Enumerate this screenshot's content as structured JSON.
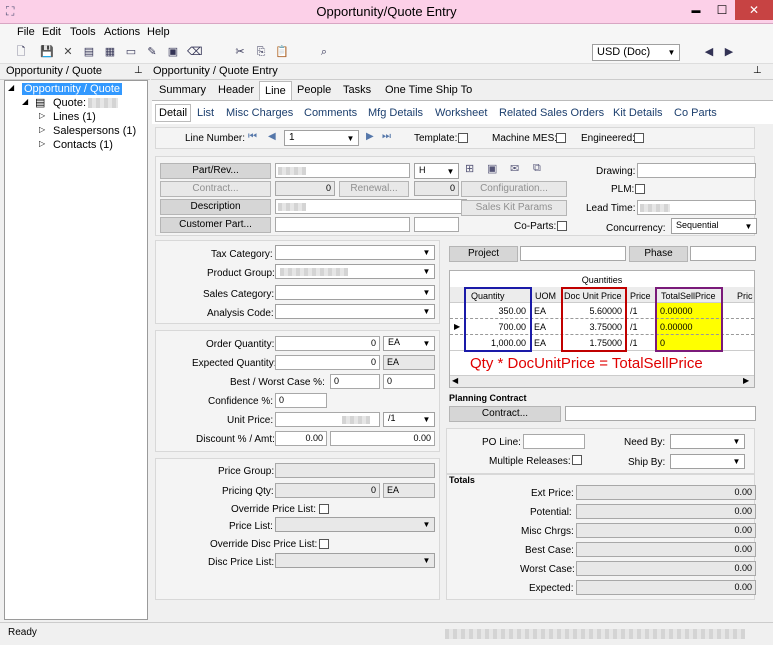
{
  "window": {
    "title": "Opportunity/Quote Entry",
    "minimize": "▬",
    "maximize": "☐",
    "close": "✕"
  },
  "menu": [
    "File",
    "Edit",
    "Tools",
    "Actions",
    "Help"
  ],
  "toolbar": {
    "currency": "USD (Doc)"
  },
  "tree": {
    "header": "Opportunity / Quote",
    "root": "Opportunity / Quote",
    "quote": "Quote:",
    "children": [
      "Lines (1)",
      "Salespersons (1)",
      "Contacts (1)"
    ]
  },
  "main": {
    "header": "Opportunity / Quote Entry",
    "tabs": [
      "Summary",
      "Header",
      "Line",
      "People",
      "Tasks",
      "One Time Ship To"
    ],
    "subtabs": [
      "Detail",
      "List",
      "Misc Charges",
      "Comments",
      "Mfg Details",
      "Worksheet",
      "Related Sales Orders",
      "Kit Details",
      "Co Parts"
    ]
  },
  "line_nav": {
    "label": "Line Number:",
    "value": "1",
    "template": "Template:",
    "machine_mes": "Machine MES:",
    "engineered": "Engineered:"
  },
  "part": {
    "part_rev": "Part/Rev...",
    "rev_value": "H",
    "contract": "Contract...",
    "contract_value": "0",
    "renewal": "Renewal...",
    "renewal_value": "0",
    "configuration": "Configuration...",
    "description": "Description",
    "sales_kit": "Sales Kit Params",
    "customer_part": "Customer Part...",
    "co_parts": "Co-Parts:",
    "drawing": "Drawing:",
    "plm": "PLM:",
    "lead_time": "Lead Time:",
    "concurrency": "Concurrency:",
    "concurrency_value": "Sequential"
  },
  "categories": {
    "tax": "Tax Category:",
    "product": "Product Group:",
    "sales": "Sales Category:",
    "analysis": "Analysis Code:"
  },
  "quantities": {
    "order_qty": "Order Quantity:",
    "order_qty_value": "0",
    "order_uom": "EA",
    "expected_qty": "Expected Quantity:",
    "expected_qty_value": "0",
    "expected_uom": "EA",
    "best_worst": "Best / Worst Case %:",
    "best_value": "0",
    "worst_value": "0",
    "confidence": "Confidence %:",
    "confidence_value": "0",
    "unit_price": "Unit Price:",
    "unit_price_per": "/1",
    "discount": "Discount % / Amt:",
    "discount_pct": "0.00",
    "discount_amt": "0.00"
  },
  "pricing": {
    "price_group": "Price Group:",
    "pricing_qty": "Pricing Qty:",
    "pricing_qty_value": "0",
    "pricing_uom": "EA",
    "override_price_list": "Override Price List:",
    "price_list": "Price List:",
    "override_disc": "Override Disc Price List:",
    "disc_price_list": "Disc Price List:"
  },
  "project": {
    "project": "Project",
    "phase": "Phase"
  },
  "qty_grid": {
    "title": "Quantities",
    "headers": [
      "Quantity",
      "UOM",
      "Doc Unit Price",
      "Price",
      "TotalSellPrice",
      "Pric"
    ],
    "rows": [
      {
        "qty": "350.00",
        "uom": "EA",
        "price": "5.60000",
        "per": "/1",
        "total": "0.00000"
      },
      {
        "qty": "700.00",
        "uom": "EA",
        "price": "3.75000",
        "per": "/1",
        "total": "0.00000"
      },
      {
        "qty": "1,000.00",
        "uom": "EA",
        "price": "1.75000",
        "per": "/1",
        "total": "0"
      }
    ],
    "annotation": "Qty * DocUnitPrice = TotalSellPrice",
    "colors": {
      "qty_box": "#1a1aa8",
      "price_box": "#c00000",
      "total_box": "#7a1a7a",
      "highlight": "#ffff00",
      "annotation": "#e00000"
    }
  },
  "planning": {
    "title": "Planning Contract",
    "contract": "Contract..."
  },
  "po": {
    "po_line": "PO Line:",
    "multiple_releases": "Multiple Releases:",
    "need_by": "Need By:",
    "ship_by": "Ship By:"
  },
  "totals": {
    "title": "Totals",
    "rows": [
      {
        "label": "Ext Price:",
        "value": "0.00"
      },
      {
        "label": "Potential:",
        "value": "0.00"
      },
      {
        "label": "Misc Chrgs:",
        "value": "0.00"
      },
      {
        "label": "Best Case:",
        "value": "0.00"
      },
      {
        "label": "Worst Case:",
        "value": "0.00"
      },
      {
        "label": "Expected:",
        "value": "0.00"
      }
    ]
  },
  "status": {
    "text": "Ready"
  }
}
